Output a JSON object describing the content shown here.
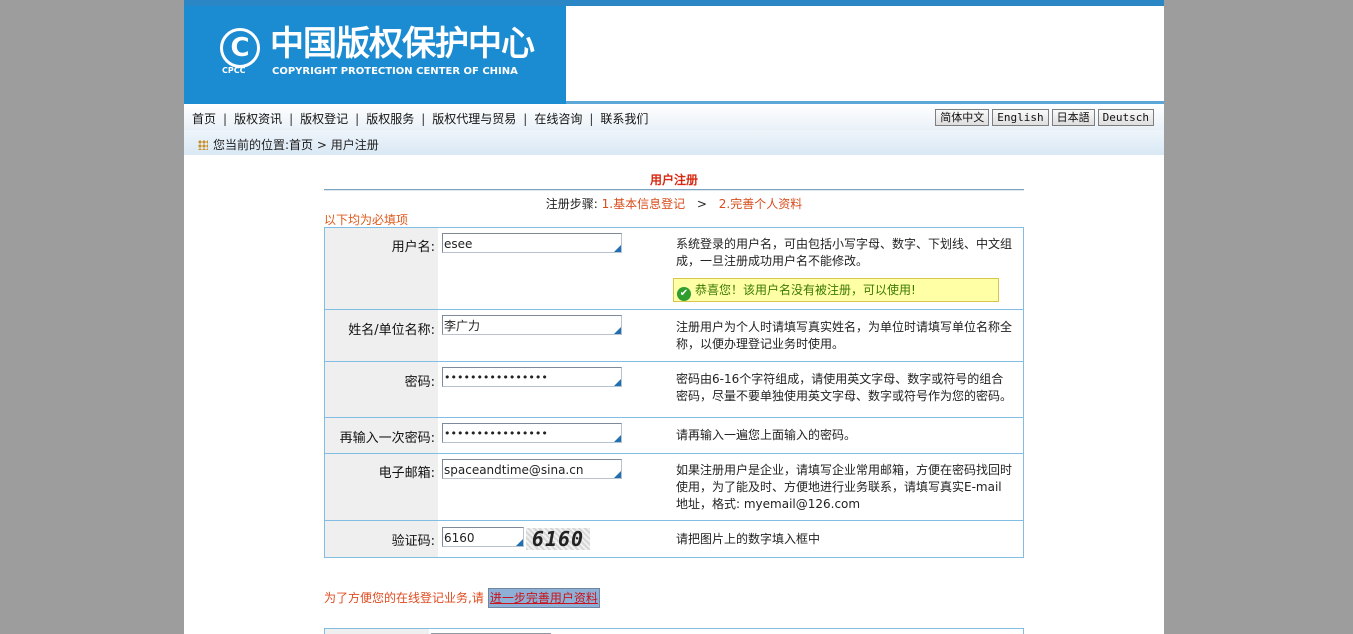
{
  "header": {
    "logo_c": "C",
    "logo_cpcc": "CPCC",
    "logo_cn": "中国版权保护中心",
    "logo_en": "COPYRIGHT PROTECTION CENTER OF CHINA"
  },
  "nav": {
    "items": [
      "首页",
      "版权资讯",
      "版权登记",
      "版权服务",
      "版权代理与贸易",
      "在线咨询",
      "联系我们"
    ],
    "separator": "|"
  },
  "languages": [
    "简体中文",
    "English",
    "日本語",
    "Deutsch"
  ],
  "breadcrumb": {
    "prefix": "您当前的位置:",
    "home": "首页",
    "arrow": ">",
    "current": "用户注册"
  },
  "form": {
    "title": "用户注册",
    "steps_label": "注册步骤:",
    "step1": "1.基本信息登记",
    "arrow": ">",
    "step2": "2.完善个人资料",
    "required_note": "以下均为必填项",
    "rows": [
      {
        "label": "用户名:",
        "value": "esee",
        "hint": "系统登录的用户名，可由包括小写字母、数字、下划线、中文组成，一旦注册成功用户名不能修改。",
        "ok_message": "恭喜您！该用户名没有被注册，可以使用!"
      },
      {
        "label": "姓名/单位名称:",
        "value": "李广力",
        "hint": "注册用户为个人时请填写真实姓名，为单位时请填写单位名称全称，以便办理登记业务时使用。"
      },
      {
        "label": "密码:",
        "value": "••••••••••••••••",
        "hint": "密码由6-16个字符组成，请使用英文字母、数字或符号的组合密码，尽量不要单独使用英文字母、数字或符号作为您的密码。"
      },
      {
        "label": "再输入一次密码:",
        "value": "••••••••••••••••",
        "hint": "请再输入一遍您上面输入的密码。"
      },
      {
        "label": "电子邮箱:",
        "value": "spaceandtime@sina.cn",
        "hint": "如果注册用户是企业，请填写企业常用邮箱，方便在密码找回时使用，为了能及时、方便地进行业务联系，请填写真实E-mail地址，格式: myemail@126.com"
      },
      {
        "label": "验证码:",
        "value": "6160",
        "captcha": "6160",
        "hint": "请把图片上的数字填入框中"
      }
    ],
    "footer_note": "为了方便您的在线登记业务,请",
    "footer_button": "进一步完善用户资料"
  },
  "colors": {
    "header_blue": "#1b8bd2",
    "accent_red": "#d82a12",
    "border_blue": "#82bde3"
  }
}
